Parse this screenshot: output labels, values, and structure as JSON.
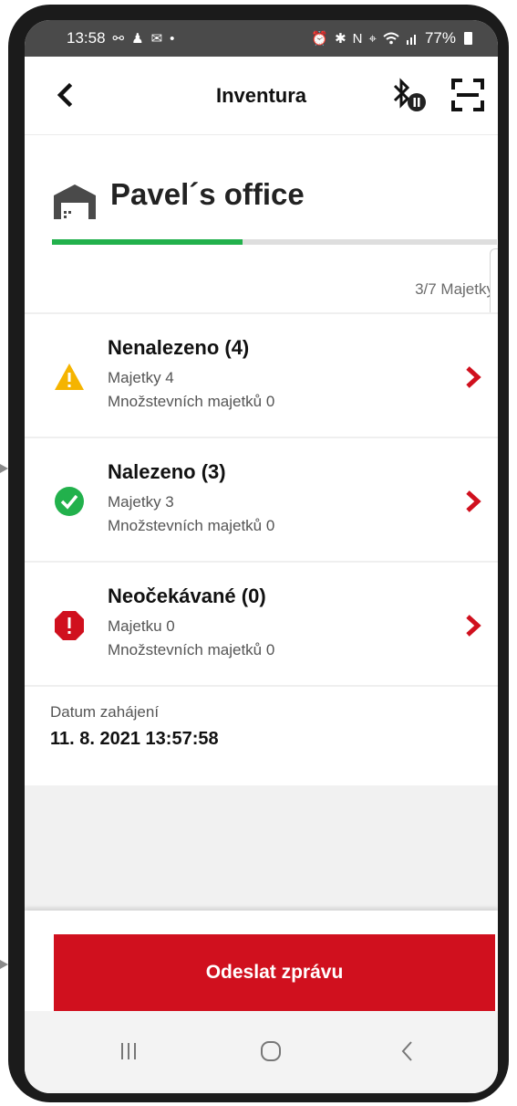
{
  "status_bar": {
    "time": "13:58",
    "left_icons": [
      "hotspot-icon",
      "person-icon",
      "message-icon",
      "dot-icon"
    ],
    "right_icons": [
      "alarm-icon",
      "bluetooth-icon",
      "nfc-icon",
      "location-icon",
      "wifi-icon",
      "signal-icon"
    ],
    "battery": "77%"
  },
  "header": {
    "title": "Inventura",
    "back_icon": "chevron-left-icon",
    "bluetooth_icon": "bluetooth-paused-icon",
    "scan_icon": "scan-frame-icon"
  },
  "location": {
    "icon": "warehouse-icon",
    "name": "Pavel´s office",
    "progress_fraction": 0.4286,
    "count_text": "3/7 Majetky"
  },
  "results": [
    {
      "title": "Nenalezeno (4)",
      "line1": "Majetky 4",
      "line2": "Množstevních majetků 0",
      "icon": "warning-triangle-icon",
      "color": "#f5b400"
    },
    {
      "title": "Nalezeno (3)",
      "line1": "Majetky 3",
      "line2": "Množstevních majetků 0",
      "icon": "check-circle-icon",
      "color": "#22b14c"
    },
    {
      "title": "Neočekávané (0)",
      "line1": "Majetku 0",
      "line2": "Množstevních majetků 0",
      "icon": "error-octagon-icon",
      "color": "#d0101e"
    }
  ],
  "start": {
    "label": "Datum zahájení",
    "value": "11. 8. 2021 13:57:58"
  },
  "actions": {
    "send_label": "Odeslat zprávu"
  },
  "colors": {
    "accent": "#d0101e",
    "progress": "#22b14c"
  },
  "nav": [
    "recent-apps-icon",
    "home-icon",
    "back-icon"
  ]
}
